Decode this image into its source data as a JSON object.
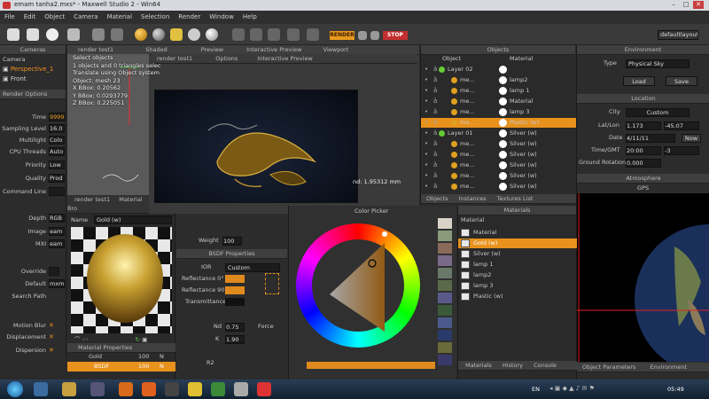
{
  "window": {
    "title": "emam tanha2.mxs* - Maxwell Studio 2 - Win64"
  },
  "menu": [
    "File",
    "Edit",
    "Object",
    "Camera",
    "Material",
    "Selection",
    "Render",
    "Window",
    "Help"
  ],
  "toolbar": {
    "render_label": "RENDER",
    "stop_label": "STOP",
    "layout_value": "defaultlayout"
  },
  "cameras": {
    "title": "Cameras",
    "tab": "Camera",
    "items": [
      "Perspective_1",
      "Front"
    ]
  },
  "render_options": {
    "title": "Render Options",
    "rows": [
      {
        "label": "Time",
        "value": "9999"
      },
      {
        "label": "Sampling Level",
        "value": "16.0"
      },
      {
        "label": "Multilight",
        "value": "Colo"
      },
      {
        "label": "CPU Threads",
        "value": "Auto"
      },
      {
        "label": "Priority",
        "value": "Low"
      },
      {
        "label": "Quality",
        "value": "Prod"
      },
      {
        "label": "Command Line",
        "value": ""
      }
    ]
  },
  "output": {
    "rows": [
      {
        "label": "Depth",
        "value": "RGB"
      },
      {
        "label": "Image",
        "value": "eam"
      },
      {
        "label": "MXI",
        "value": "eam"
      }
    ]
  },
  "override": {
    "rows": [
      {
        "label": "Override",
        "value": ""
      },
      {
        "label": "Default",
        "value": "mxm"
      },
      {
        "label": "Search Path",
        "value": ""
      }
    ]
  },
  "effects": {
    "rows": [
      {
        "label": "Motion Blur",
        "value": "✕"
      },
      {
        "label": "Displacement",
        "value": "✕"
      },
      {
        "label": "Dispersion",
        "value": "✕"
      }
    ]
  },
  "viewport_tabs": {
    "left": [
      "render test1",
      "Shaded",
      "Preview",
      "Interactive Preview",
      "Viewport"
    ],
    "sub": [
      "render test1",
      "Options",
      "Interactive Preview"
    ]
  },
  "viewport_info": [
    "Select objects",
    "1 objects and 0 triangles selec",
    "Translate using Object system",
    "Object: mesh 23",
    "X BBox: 0.20562",
    "Y BBox: 0.0293779",
    "Z BBox: 0.225051"
  ],
  "viewport_measure": "nd: 1.95312 mm",
  "viewport_bottom_tabs": [
    "render test1",
    "Material Bro"
  ],
  "objects": {
    "title": "Objects",
    "col_object": "Object",
    "col_material": "Material",
    "rows": [
      {
        "name": "Layer 02",
        "material": "",
        "layer": true
      },
      {
        "name": "me...",
        "material": "lamp2"
      },
      {
        "name": "me...",
        "material": "lamp 1"
      },
      {
        "name": "me...",
        "material": "Material"
      },
      {
        "name": "me...",
        "material": "lamp 3"
      },
      {
        "name": "me...",
        "material": "Plastic (w)",
        "selected": true
      },
      {
        "name": "Layer 01",
        "material": "Silver (w)",
        "layer": true
      },
      {
        "name": "me...",
        "material": "Silver (w)"
      },
      {
        "name": "me...",
        "material": "Silver (w)"
      },
      {
        "name": "me...",
        "material": "Silver (w)"
      },
      {
        "name": "me...",
        "material": "Silver (w)"
      },
      {
        "name": "me...",
        "material": "Silver (w)"
      }
    ],
    "tabs": [
      "Objects",
      "Instances",
      "Textures List"
    ]
  },
  "environment": {
    "title": "Environment",
    "type_label": "Type",
    "type_value": "Physical Sky",
    "load": "Load",
    "save": "Save",
    "location_title": "Location",
    "city_label": "City",
    "city_value": "Custom",
    "latlon_label": "Lat/Lon",
    "lat": "1.173",
    "lon": "-45.07",
    "date_label": "Date",
    "date_value": "4/11/11",
    "now": "Now",
    "time_label": "Time/GMT",
    "time_value": "20:00",
    "gmt": "-3",
    "ground_label": "Ground Rotation",
    "ground_value": "0.000",
    "atmosphere_title": "Atmosphere",
    "gps_label": "GPS",
    "tabs": [
      "Object Parameters",
      "Environment"
    ]
  },
  "material_editor": {
    "name_label": "Name",
    "name_value": "Gold (w)",
    "props_title": "Material Properties",
    "tree": [
      {
        "label": "Gold",
        "value": "100",
        "extra": "N"
      },
      {
        "label": "BSDF",
        "value": "100",
        "extra": "N",
        "selected": true
      }
    ]
  },
  "bsdf": {
    "weight_label": "Weight",
    "weight_value": "100",
    "title": "BSDF Properties",
    "ior_label": "IOR",
    "ior_value": "Custom",
    "reflectance0": "Reflectance 0°",
    "reflectance90": "Reflectance 90°",
    "transmittance": "Transmittance",
    "nd_label": "Nd",
    "nd_value": "0.75",
    "k_label": "K",
    "k_value": "1.90",
    "force": "Force",
    "r2_label": "R2",
    "color_accent": "#e08a1e"
  },
  "color_picker": {
    "title": "Color Picker",
    "swatch_color": "#e08a1e",
    "palette": [
      "#d8d2c8",
      "#8a9a7a",
      "#8a6a5a",
      "#7a6a8a",
      "#6a7a6a",
      "#5a6a4a",
      "#5a5a8a",
      "#3a5a3a",
      "#4a5a8a",
      "#2a3a6a",
      "#6a6a3a",
      "#3a3a6a"
    ]
  },
  "materials": {
    "title": "Materials",
    "items": [
      {
        "label": "Material"
      },
      {
        "label": "Gold (w)",
        "selected": true
      },
      {
        "label": "Silver (w)"
      },
      {
        "label": "lamp 1"
      },
      {
        "label": "lamp2"
      },
      {
        "label": "lamp 3"
      },
      {
        "label": "Plastic (w)"
      }
    ],
    "tabs": [
      "Materials",
      "History",
      "Console"
    ]
  },
  "taskbar": {
    "lang": "EN",
    "time": "05:49"
  },
  "colors": {
    "accent": "#f0961e",
    "panel": "#2f2f2f",
    "dark": "#1a1a1a"
  }
}
